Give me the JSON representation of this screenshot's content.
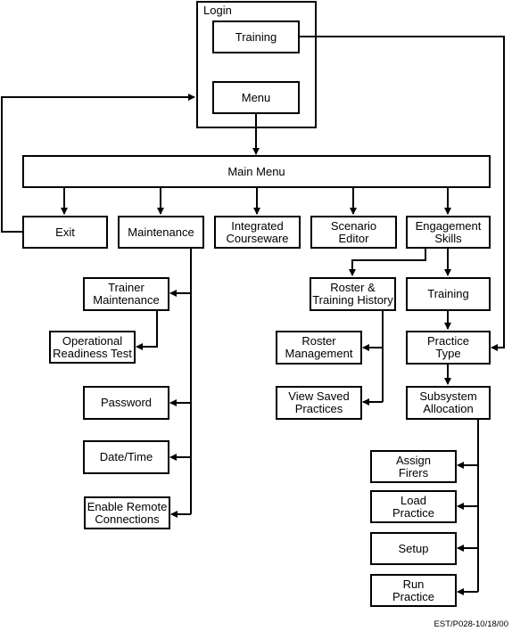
{
  "diagram": {
    "login_group": {
      "label": "Login",
      "training": "Training",
      "menu": "Menu"
    },
    "main_menu": "Main Menu",
    "main_options": {
      "exit": "Exit",
      "maintenance": "Maintenance",
      "integrated_courseware": "Integrated\nCourseware",
      "scenario_editor": "Scenario\nEditor",
      "engagement_skills": "Engagement\nSkills"
    },
    "maintenance_items": {
      "trainer_maintenance": "Trainer\nMaintenance",
      "operational_readiness_test": "Operational\nReadiness Test",
      "password": "Password",
      "date_time": "Date/Time",
      "enable_remote_connections": "Enable Remote\nConnections"
    },
    "engagement_items": {
      "roster_training_history": "Roster &\nTraining History",
      "roster_management": "Roster\nManagement",
      "view_saved_practices": "View Saved\nPractices",
      "training": "Training",
      "practice_type": "Practice\nType",
      "subsystem_allocation": "Subsystem\nAllocation"
    },
    "subsystem_items": {
      "assign_firers": "Assign\nFirers",
      "load_practice": "Load\nPractice",
      "setup": "Setup",
      "run_practice": "Run\nPractice"
    },
    "footer_id": "EST/P028-10/18/00"
  }
}
